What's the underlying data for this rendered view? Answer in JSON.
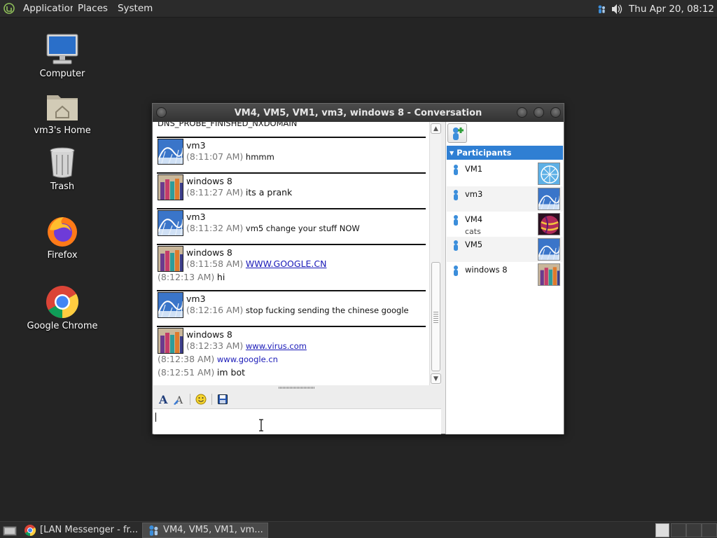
{
  "top_panel": {
    "menus": [
      "Applications",
      "Places",
      "System"
    ],
    "clock": "Thu Apr 20, 08:12"
  },
  "desktop": {
    "icons": [
      {
        "label": "Computer",
        "icon": "computer-icon"
      },
      {
        "label": "vm3's Home",
        "icon": "home-folder-icon"
      },
      {
        "label": "Trash",
        "icon": "trash-icon"
      },
      {
        "label": "Firefox",
        "icon": "firefox-icon"
      },
      {
        "label": "Google Chrome",
        "icon": "chrome-icon"
      }
    ]
  },
  "window": {
    "title": "VM4, VM5, VM1, vm3, windows 8 - Conversation"
  },
  "chat": {
    "partial_top_line": "DNS_PROBE_FINISHED_NXDOMAIN",
    "messages": [
      {
        "sender": "vm3",
        "lines": [
          {
            "time": "(8:11:07 AM)",
            "text": "hmmm"
          }
        ]
      },
      {
        "sender": "windows 8",
        "lines": [
          {
            "time": "(8:11:27 AM)",
            "text": "its a prank"
          }
        ]
      },
      {
        "sender": "vm3",
        "lines": [
          {
            "time": "(8:11:32 AM)",
            "text": "vm5 change your stuff NOW"
          }
        ]
      },
      {
        "sender": "windows 8",
        "lines": [
          {
            "time": "(8:11:58 AM)",
            "text": "WWW.GOOGLE.CN"
          },
          {
            "time": "(8:12:13 AM)",
            "text": "hi"
          }
        ]
      },
      {
        "sender": "vm3",
        "lines": [
          {
            "time": "(8:12:16 AM)",
            "text": "stop fucking sending the chinese google"
          }
        ]
      },
      {
        "sender": "windows 8",
        "lines": [
          {
            "time": "(8:12:33 AM)",
            "text": "www.virus.com"
          },
          {
            "time": "(8:12:38 AM)",
            "text": "www.google.cn"
          },
          {
            "time": "(8:12:51 AM)",
            "text": "im bot"
          }
        ]
      }
    ]
  },
  "participants": {
    "header": "Participants",
    "list": [
      {
        "name": "VM1",
        "note": "",
        "avatar": "ferris-wheel"
      },
      {
        "name": "vm3",
        "note": "",
        "avatar": "roller-coaster"
      },
      {
        "name": "VM4",
        "note": "cats",
        "avatar": "ball"
      },
      {
        "name": "VM5",
        "note": "",
        "avatar": "roller-coaster"
      },
      {
        "name": "windows 8",
        "note": "",
        "avatar": "crayons"
      }
    ]
  },
  "taskbar": {
    "tasks": [
      "[LAN Messenger - fr...",
      "VM4, VM5, VM1, vm..."
    ]
  },
  "colors": {
    "desktop_bg": "#242424",
    "panel_bg": "#2b2b2b",
    "participants_header": "#2f7fd3",
    "link": "#1a1ab8"
  }
}
